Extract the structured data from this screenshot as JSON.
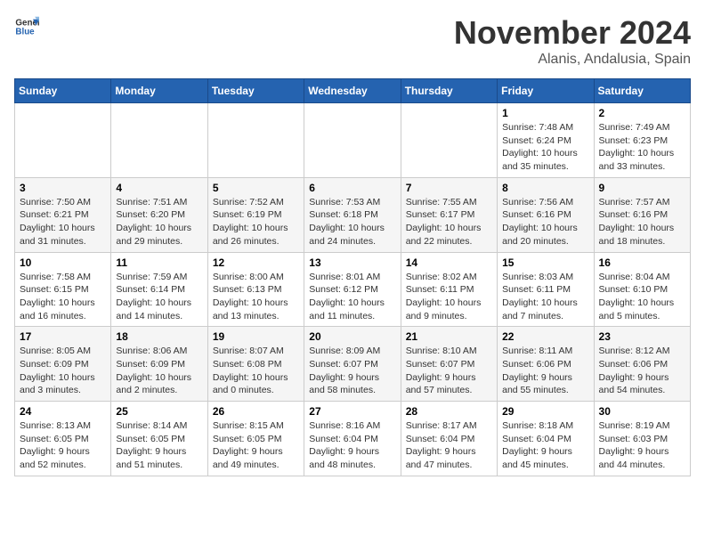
{
  "header": {
    "logo_line1": "General",
    "logo_line2": "Blue",
    "month": "November 2024",
    "location": "Alanis, Andalusia, Spain"
  },
  "days_of_week": [
    "Sunday",
    "Monday",
    "Tuesday",
    "Wednesday",
    "Thursday",
    "Friday",
    "Saturday"
  ],
  "weeks": [
    [
      {
        "day": "",
        "info": ""
      },
      {
        "day": "",
        "info": ""
      },
      {
        "day": "",
        "info": ""
      },
      {
        "day": "",
        "info": ""
      },
      {
        "day": "",
        "info": ""
      },
      {
        "day": "1",
        "info": "Sunrise: 7:48 AM\nSunset: 6:24 PM\nDaylight: 10 hours and 35 minutes."
      },
      {
        "day": "2",
        "info": "Sunrise: 7:49 AM\nSunset: 6:23 PM\nDaylight: 10 hours and 33 minutes."
      }
    ],
    [
      {
        "day": "3",
        "info": "Sunrise: 7:50 AM\nSunset: 6:21 PM\nDaylight: 10 hours and 31 minutes."
      },
      {
        "day": "4",
        "info": "Sunrise: 7:51 AM\nSunset: 6:20 PM\nDaylight: 10 hours and 29 minutes."
      },
      {
        "day": "5",
        "info": "Sunrise: 7:52 AM\nSunset: 6:19 PM\nDaylight: 10 hours and 26 minutes."
      },
      {
        "day": "6",
        "info": "Sunrise: 7:53 AM\nSunset: 6:18 PM\nDaylight: 10 hours and 24 minutes."
      },
      {
        "day": "7",
        "info": "Sunrise: 7:55 AM\nSunset: 6:17 PM\nDaylight: 10 hours and 22 minutes."
      },
      {
        "day": "8",
        "info": "Sunrise: 7:56 AM\nSunset: 6:16 PM\nDaylight: 10 hours and 20 minutes."
      },
      {
        "day": "9",
        "info": "Sunrise: 7:57 AM\nSunset: 6:16 PM\nDaylight: 10 hours and 18 minutes."
      }
    ],
    [
      {
        "day": "10",
        "info": "Sunrise: 7:58 AM\nSunset: 6:15 PM\nDaylight: 10 hours and 16 minutes."
      },
      {
        "day": "11",
        "info": "Sunrise: 7:59 AM\nSunset: 6:14 PM\nDaylight: 10 hours and 14 minutes."
      },
      {
        "day": "12",
        "info": "Sunrise: 8:00 AM\nSunset: 6:13 PM\nDaylight: 10 hours and 13 minutes."
      },
      {
        "day": "13",
        "info": "Sunrise: 8:01 AM\nSunset: 6:12 PM\nDaylight: 10 hours and 11 minutes."
      },
      {
        "day": "14",
        "info": "Sunrise: 8:02 AM\nSunset: 6:11 PM\nDaylight: 10 hours and 9 minutes."
      },
      {
        "day": "15",
        "info": "Sunrise: 8:03 AM\nSunset: 6:11 PM\nDaylight: 10 hours and 7 minutes."
      },
      {
        "day": "16",
        "info": "Sunrise: 8:04 AM\nSunset: 6:10 PM\nDaylight: 10 hours and 5 minutes."
      }
    ],
    [
      {
        "day": "17",
        "info": "Sunrise: 8:05 AM\nSunset: 6:09 PM\nDaylight: 10 hours and 3 minutes."
      },
      {
        "day": "18",
        "info": "Sunrise: 8:06 AM\nSunset: 6:09 PM\nDaylight: 10 hours and 2 minutes."
      },
      {
        "day": "19",
        "info": "Sunrise: 8:07 AM\nSunset: 6:08 PM\nDaylight: 10 hours and 0 minutes."
      },
      {
        "day": "20",
        "info": "Sunrise: 8:09 AM\nSunset: 6:07 PM\nDaylight: 9 hours and 58 minutes."
      },
      {
        "day": "21",
        "info": "Sunrise: 8:10 AM\nSunset: 6:07 PM\nDaylight: 9 hours and 57 minutes."
      },
      {
        "day": "22",
        "info": "Sunrise: 8:11 AM\nSunset: 6:06 PM\nDaylight: 9 hours and 55 minutes."
      },
      {
        "day": "23",
        "info": "Sunrise: 8:12 AM\nSunset: 6:06 PM\nDaylight: 9 hours and 54 minutes."
      }
    ],
    [
      {
        "day": "24",
        "info": "Sunrise: 8:13 AM\nSunset: 6:05 PM\nDaylight: 9 hours and 52 minutes."
      },
      {
        "day": "25",
        "info": "Sunrise: 8:14 AM\nSunset: 6:05 PM\nDaylight: 9 hours and 51 minutes."
      },
      {
        "day": "26",
        "info": "Sunrise: 8:15 AM\nSunset: 6:05 PM\nDaylight: 9 hours and 49 minutes."
      },
      {
        "day": "27",
        "info": "Sunrise: 8:16 AM\nSunset: 6:04 PM\nDaylight: 9 hours and 48 minutes."
      },
      {
        "day": "28",
        "info": "Sunrise: 8:17 AM\nSunset: 6:04 PM\nDaylight: 9 hours and 47 minutes."
      },
      {
        "day": "29",
        "info": "Sunrise: 8:18 AM\nSunset: 6:04 PM\nDaylight: 9 hours and 45 minutes."
      },
      {
        "day": "30",
        "info": "Sunrise: 8:19 AM\nSunset: 6:03 PM\nDaylight: 9 hours and 44 minutes."
      }
    ]
  ]
}
